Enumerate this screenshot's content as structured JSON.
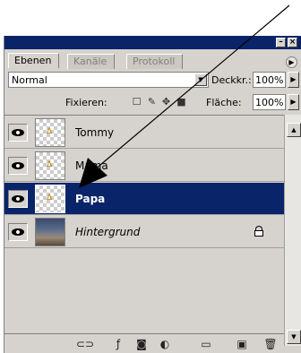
{
  "tabs": [
    {
      "label": "Ebenen"
    },
    {
      "label": "Kanäle"
    },
    {
      "label": "Protokoll"
    }
  ],
  "blend_mode": "Normal",
  "opacity": {
    "label": "Deckkr.:",
    "value": "100%"
  },
  "lock_label": "Fixieren:",
  "fill": {
    "label": "Fläche:",
    "value": "100%"
  },
  "layers": [
    {
      "name": "Tommy"
    },
    {
      "name": "Mama"
    },
    {
      "name": "Papa"
    },
    {
      "name": "Hintergrund"
    }
  ],
  "icons": {
    "lock_transparent": "checkbox-icon",
    "lock_paint": "brush-icon",
    "lock_move": "move-icon",
    "lock_all": "lock-icon"
  },
  "colors": {
    "selection": "#0a246a",
    "panel": "#d6d3ce"
  }
}
